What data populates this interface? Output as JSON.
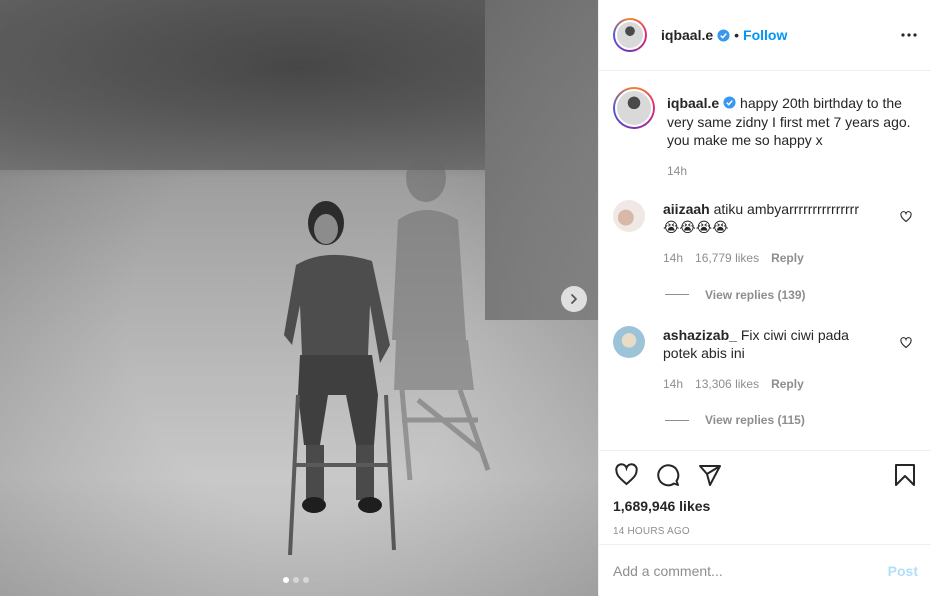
{
  "post": {
    "username": "iqbaal.e",
    "follow_label": "Follow",
    "separator": "•",
    "caption": "happy 20th birthday to the very same zidny I first met 7 years ago. you make me so happy x",
    "caption_age": "14h",
    "likes": "1,689,946 likes",
    "timestamp": "14 hours ago"
  },
  "comments": [
    {
      "username": "aiizaah",
      "text": "atiku ambyarrrrrrrrrrrrrrr",
      "emoji": "😭😭😭😭",
      "age": "14h",
      "likes": "16,779 likes",
      "reply_label": "Reply",
      "view_replies": "View replies (139)"
    },
    {
      "username": "ashazizab_",
      "text": "Fix ciwi ciwi pada potek abis ini",
      "age": "14h",
      "likes": "13,306 likes",
      "reply_label": "Reply",
      "view_replies": "View replies (115)"
    }
  ],
  "add_comment": {
    "placeholder": "Add a comment...",
    "post_label": "Post"
  },
  "carousel": {
    "total": 3,
    "active_index": 0
  },
  "icons": [
    "verified-badge-icon",
    "more-options-icon",
    "heart-icon",
    "comment-icon",
    "share-icon",
    "bookmark-icon",
    "chevron-right-icon"
  ],
  "colors": {
    "accent": "#0095f6",
    "post_disabled": "#b2dffc",
    "muted": "#8e8e8e",
    "text": "#262626",
    "border": "#efefef"
  }
}
